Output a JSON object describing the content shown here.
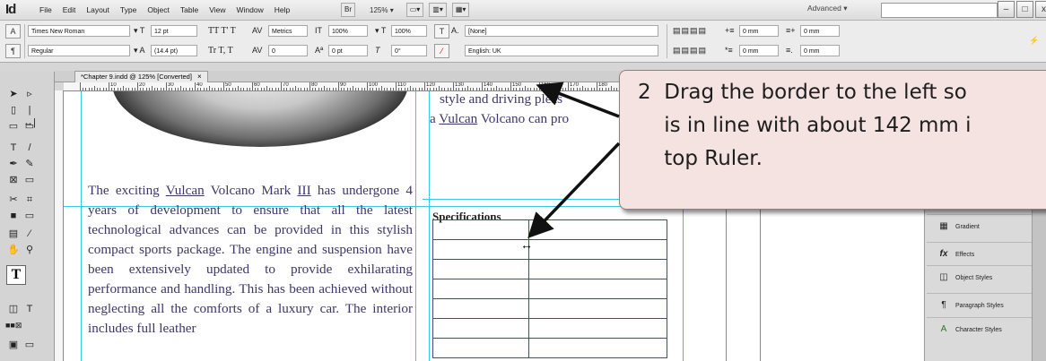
{
  "app": {
    "logo": "Id"
  },
  "menubar": {
    "items": [
      "File",
      "Edit",
      "Layout",
      "Type",
      "Object",
      "Table",
      "View",
      "Window",
      "Help"
    ],
    "br_button": "Br",
    "zoom": "125%",
    "workspace": "Advanced"
  },
  "window_controls": {
    "minimize": "–",
    "maximize": "□",
    "close": "x"
  },
  "control_panel": {
    "font_family": "Times New Roman",
    "font_style": "Regular",
    "font_size": "12 pt",
    "leading": "(14.4 pt)",
    "kerning": "Metrics",
    "tracking": "0",
    "vertical_scale": "100%",
    "horizontal_scale": "100%",
    "baseline_shift": "0 pt",
    "skew": "0°",
    "character_style": "[None]",
    "language": "English: UK",
    "indent_left": "0 mm",
    "indent_first": "0 mm",
    "indent_right": "0 mm",
    "indent_last": "0 mm"
  },
  "document": {
    "tab_title": "*Chapter 9.indd @ 125% [Converted]",
    "tab_close": "×",
    "ruler_numbers": [
      "10",
      "20",
      "30",
      "40",
      "50",
      "60",
      "70",
      "80",
      "90",
      "100",
      "110",
      "120",
      "130",
      "140",
      "150",
      "160",
      "170",
      "180"
    ]
  },
  "page": {
    "body_lines": [
      "The exciting ",
      "Vulcan",
      " Volcano Mark ",
      "III",
      " has undergone 4 years of development to ensure that all the latest technological advances can be provided in this stylish compact sports package. The engine and suspension have been extensively updated to provide exhilarating performance and handling.  This has been achieved without neglecting all the comforts of a luxury car. The interior includes full leather"
    ],
    "col_line1": "style and driving pleas",
    "col_line2_pre": "a ",
    "col_line2_ul": "Vulcan",
    "col_line2_post": " Volcano can pro",
    "spec_heading": "Specifications",
    "cursor": "↔"
  },
  "callout": {
    "text": "2  Drag the border to the left so\n    is in line with about 142 mm i\n    top Ruler."
  },
  "right_panel": {
    "items": [
      {
        "icon": "gradient-icon",
        "glyph": "▦",
        "label": "Gradient"
      },
      {
        "icon": "effects-icon",
        "glyph": "fx",
        "label": "Effects"
      },
      {
        "icon": "object-styles-icon",
        "glyph": "◫",
        "label": "Object Styles"
      },
      {
        "icon": "paragraph-styles-icon",
        "glyph": "¶",
        "label": "Paragraph Styles"
      },
      {
        "icon": "character-styles-icon",
        "glyph": "A",
        "label": "Character Styles"
      }
    ]
  },
  "colors": {
    "guide": "#39c8e6",
    "margin": "#c57ad3",
    "text": "#3d3768",
    "table_border": "#3c4f78",
    "callout_fill": "#f5e3e2"
  }
}
